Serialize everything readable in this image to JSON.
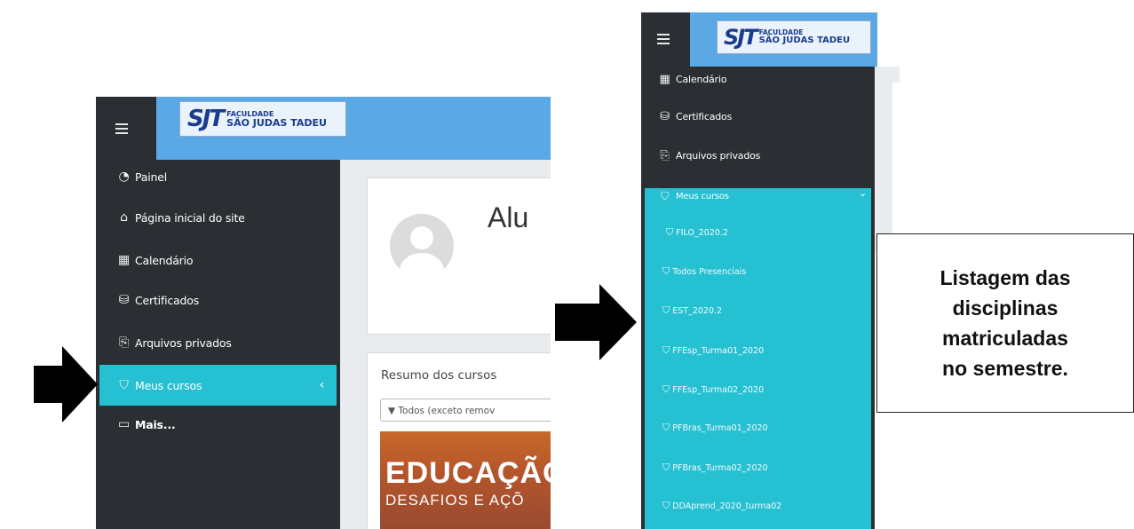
{
  "left_panel": {
    "logo": {
      "mark": "SJT",
      "line1": "FACULDADE",
      "line2": "SÃO JUDAS TADEU"
    },
    "nav": [
      {
        "icon": "dashboard-icon",
        "glyph": "◔",
        "label": "Painel"
      },
      {
        "icon": "home-icon",
        "glyph": "⌂",
        "label": "Página inicial do site"
      },
      {
        "icon": "calendar-icon",
        "glyph": "▦",
        "label": "Calendário"
      },
      {
        "icon": "certificate-icon",
        "glyph": "⛁",
        "label": "Certificados"
      },
      {
        "icon": "file-icon",
        "glyph": "⎘",
        "label": "Arquivos privados"
      },
      {
        "icon": "graduation-cap-icon",
        "glyph": "⛉",
        "label": "Meus cursos",
        "active": true,
        "chevron": "‹"
      },
      {
        "icon": "folder-icon",
        "glyph": "▭",
        "label": "Mais..."
      }
    ],
    "profile_name": "Alu",
    "course_overview": {
      "title": "Resumo dos cursos",
      "filter": "▼ Todos (exceto remov",
      "image_line1": "EDUCAÇÃO",
      "image_line2": "DESAFIOS E AÇÕ"
    }
  },
  "right_panel": {
    "logo": {
      "mark": "SJT",
      "line1": "FACULDADE",
      "line2": "SÃO JUDAS TADEU"
    },
    "nav": [
      {
        "icon": "calendar-icon",
        "glyph": "▦",
        "label": "Calendário"
      },
      {
        "icon": "certificate-icon",
        "glyph": "⛁",
        "label": "Certificados"
      },
      {
        "icon": "file-icon",
        "glyph": "⎘",
        "label": "Arquivos privados"
      },
      {
        "icon": "graduation-cap-icon",
        "glyph": "⛉",
        "label": "Meus cursos",
        "chevron": "⌄"
      }
    ],
    "courses": [
      {
        "label": "FILO_2020.2"
      },
      {
        "label": "Todos Presenciais"
      },
      {
        "label": "EST_2020.2"
      },
      {
        "label": "FFEsp_Turma01_2020"
      },
      {
        "label": "FFEsp_Turma02_2020"
      },
      {
        "label": "PFBras_Turma01_2020"
      },
      {
        "label": "PFBras_Turma02_2020"
      },
      {
        "label": "DDAprend_2020_turma02"
      }
    ]
  },
  "callout": {
    "lines": [
      "Listagem das",
      "disciplinas",
      "matriculadas",
      "no semestre."
    ]
  },
  "colors": {
    "topbar": "#5aa8e6",
    "sidebar": "#2b2f33",
    "active": "#26c0d3",
    "content_bg": "#e9ecef"
  }
}
